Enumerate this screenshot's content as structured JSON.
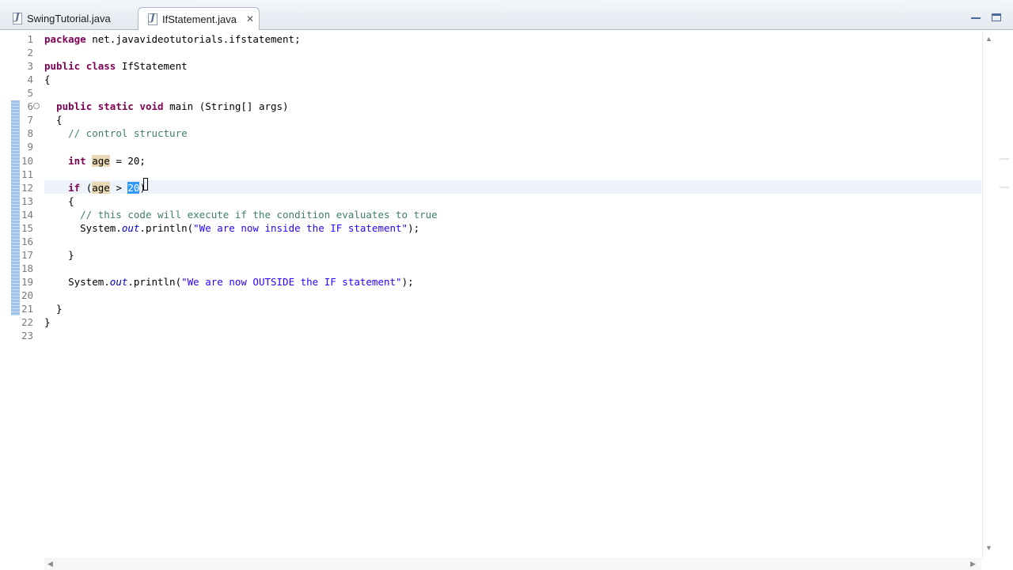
{
  "tabs": [
    {
      "label": "SwingTutorial.java",
      "active": false
    },
    {
      "label": "IfStatement.java",
      "active": true
    }
  ],
  "icons": {
    "file_icon_glyph": "J",
    "close_glyph": "✕",
    "fold_glyph": "⊖",
    "up": "▲",
    "down": "▼",
    "left": "◀",
    "right": "▶"
  },
  "editor": {
    "current_line": 12,
    "lines": [
      {
        "n": "1",
        "tokens": [
          [
            "kw",
            "package"
          ],
          [
            "",
            " net.javavideotutorials.ifstatement;"
          ]
        ]
      },
      {
        "n": "2",
        "tokens": []
      },
      {
        "n": "3",
        "tokens": [
          [
            "kw",
            "public"
          ],
          [
            "",
            " "
          ],
          [
            "kw",
            "class"
          ],
          [
            "",
            " IfStatement"
          ]
        ]
      },
      {
        "n": "4",
        "tokens": [
          [
            "",
            "{"
          ]
        ]
      },
      {
        "n": "5",
        "tokens": []
      },
      {
        "n": "6",
        "fold": true,
        "tokens": [
          [
            "",
            "  "
          ],
          [
            "kw",
            "public"
          ],
          [
            "",
            " "
          ],
          [
            "kw",
            "static"
          ],
          [
            "",
            " "
          ],
          [
            "kw",
            "void"
          ],
          [
            "",
            " main (String[] args)"
          ]
        ]
      },
      {
        "n": "7",
        "tokens": [
          [
            "",
            "  {"
          ]
        ]
      },
      {
        "n": "8",
        "tokens": [
          [
            "",
            "    "
          ],
          [
            "cm",
            "// control structure"
          ]
        ]
      },
      {
        "n": "9",
        "tokens": []
      },
      {
        "n": "10",
        "tokens": [
          [
            "",
            "    "
          ],
          [
            "kw",
            "int"
          ],
          [
            "",
            " "
          ],
          [
            "occ",
            "age"
          ],
          [
            "",
            " = 20;"
          ]
        ]
      },
      {
        "n": "11",
        "tokens": []
      },
      {
        "n": "12",
        "tokens": [
          [
            "",
            "    "
          ],
          [
            "kw",
            "if"
          ],
          [
            "",
            " ("
          ],
          [
            "occ",
            "age"
          ],
          [
            "",
            " > "
          ],
          [
            "sel",
            "20"
          ],
          [
            "",
            ")"
          ]
        ]
      },
      {
        "n": "13",
        "tokens": [
          [
            "",
            "    {"
          ]
        ]
      },
      {
        "n": "14",
        "tokens": [
          [
            "",
            "      "
          ],
          [
            "cm",
            "// this code will execute if the condition evaluates to true"
          ]
        ]
      },
      {
        "n": "15",
        "tokens": [
          [
            "",
            "      System."
          ],
          [
            "fld",
            "out"
          ],
          [
            "",
            ".println("
          ],
          [
            "str",
            "\"We are now inside the IF statement\""
          ],
          [
            "",
            ");"
          ]
        ]
      },
      {
        "n": "16",
        "tokens": []
      },
      {
        "n": "17",
        "tokens": [
          [
            "",
            "    }"
          ]
        ]
      },
      {
        "n": "18",
        "tokens": []
      },
      {
        "n": "19",
        "tokens": [
          [
            "",
            "    System."
          ],
          [
            "fld",
            "out"
          ],
          [
            "",
            ".println("
          ],
          [
            "str",
            "\"We are now OUTSIDE the IF statement\""
          ],
          [
            "",
            ");"
          ]
        ]
      },
      {
        "n": "20",
        "tokens": []
      },
      {
        "n": "21",
        "tokens": [
          [
            "",
            "  }"
          ]
        ]
      },
      {
        "n": "22",
        "tokens": [
          [
            "",
            "}"
          ]
        ]
      },
      {
        "n": "23",
        "tokens": []
      }
    ]
  }
}
